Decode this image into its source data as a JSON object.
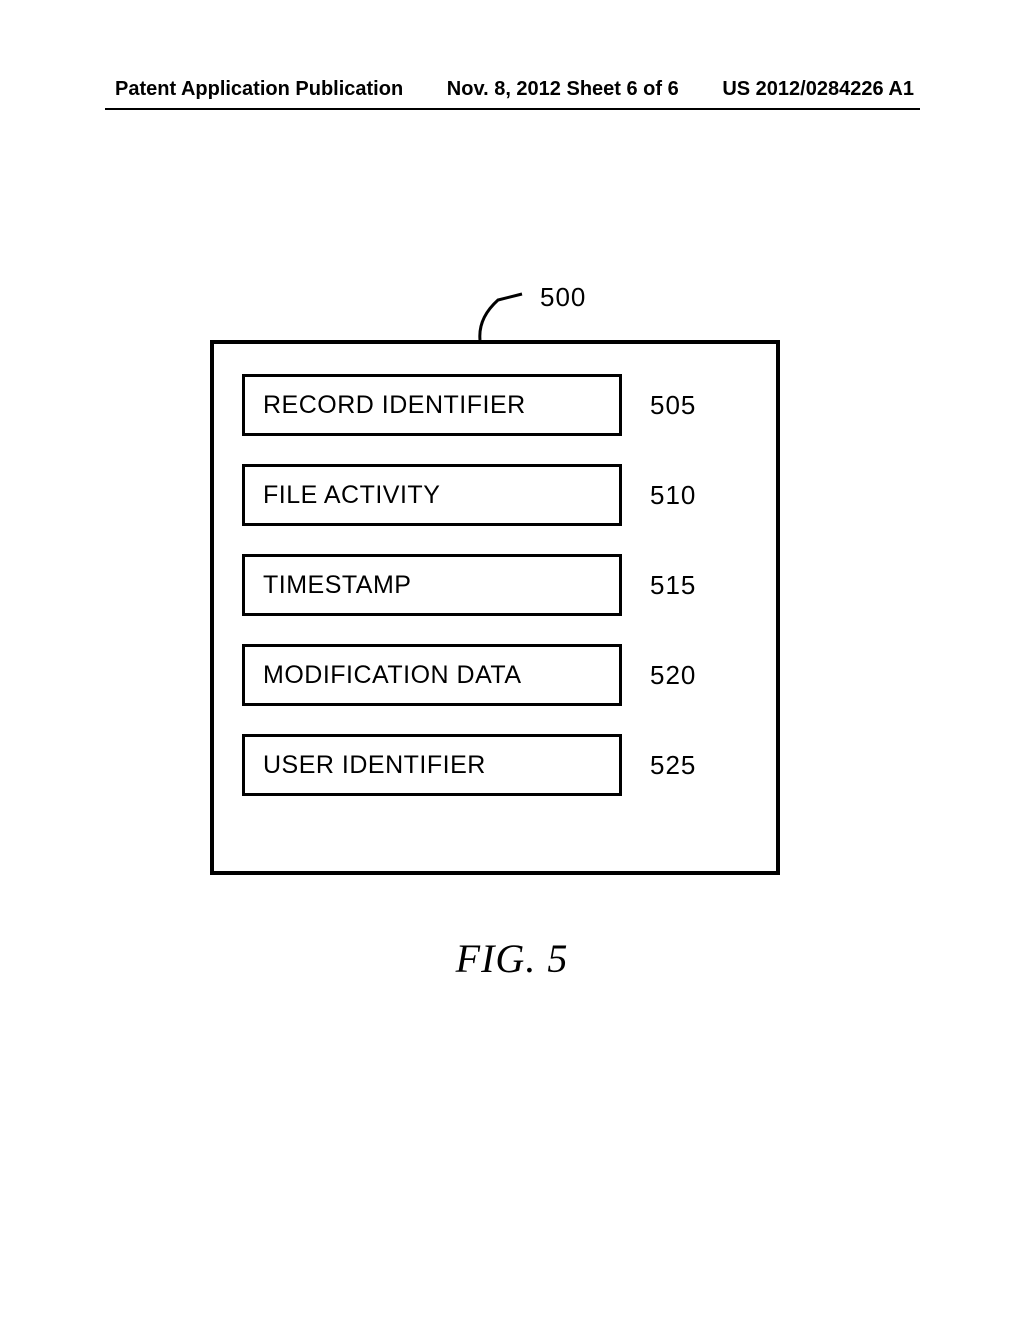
{
  "header": {
    "left": "Patent Application Publication",
    "center": "Nov. 8, 2012  Sheet 6 of 6",
    "right": "US 2012/0284226 A1"
  },
  "diagram": {
    "callout": "500",
    "fields": [
      {
        "label": "RECORD IDENTIFIER",
        "num": "505"
      },
      {
        "label": "FILE ACTIVITY",
        "num": "510"
      },
      {
        "label": "TIMESTAMP",
        "num": "515"
      },
      {
        "label": "MODIFICATION DATA",
        "num": "520"
      },
      {
        "label": "USER IDENTIFIER",
        "num": "525"
      }
    ]
  },
  "figure_caption": "FIG. 5"
}
